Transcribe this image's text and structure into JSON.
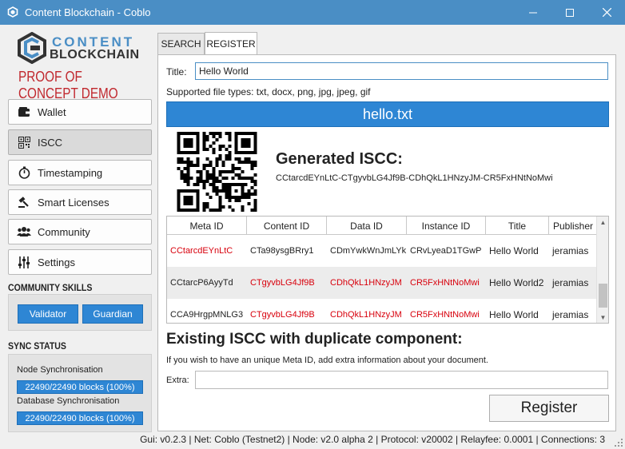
{
  "window": {
    "title": "Content Blockchain - Coblo"
  },
  "sidebar": {
    "logo": {
      "line1": "CONTENT",
      "line2": "BLOCKCHAIN"
    },
    "demo_label": "PROOF OF CONCEPT DEMO",
    "nav": [
      {
        "label": "Wallet",
        "icon": "wallet-icon"
      },
      {
        "label": "ISCC",
        "icon": "qr-code-icon"
      },
      {
        "label": "Timestamping",
        "icon": "stopwatch-icon"
      },
      {
        "label": "Smart Licenses",
        "icon": "gavel-icon"
      },
      {
        "label": "Community",
        "icon": "users-icon"
      },
      {
        "label": "Settings",
        "icon": "sliders-icon"
      }
    ],
    "active_nav": "ISCC",
    "skills_heading": "COMMUNITY SKILLS",
    "skills": {
      "validator": "Validator",
      "guardian": "Guardian"
    },
    "sync_heading": "SYNC STATUS",
    "node_sync": {
      "label": "Node Synchronisation",
      "value": "22490/22490 blocks (100%)",
      "progress": 1.0
    },
    "db_sync": {
      "label": "Database Synchronisation",
      "value": "22490/22490 blocks (100%)",
      "progress": 1.0
    }
  },
  "tabs": [
    {
      "label": "SEARCH"
    },
    {
      "label": "REGISTER"
    }
  ],
  "active_tab": "REGISTER",
  "form": {
    "title_label": "Title:",
    "title_value": "Hello World",
    "supported_types": "Supported file types: txt, docx, png, jpg, jpeg, gif",
    "file_name": "hello.txt",
    "generated_heading": "Generated ISCC:",
    "generated_code": "CCtarcdEYnLtC-CTgyvbLG4Jf9B-CDhQkL1HNzyJM-CR5FxHNtNoMwi"
  },
  "table": {
    "columns": [
      "Meta ID",
      "Content ID",
      "Data ID",
      "Instance ID",
      "Title",
      "Publisher"
    ],
    "rows": [
      {
        "cells": [
          "CCtarcdEYnLtC",
          "CTa98ysgBRry1",
          "CDmYwkWnJmLYk",
          "CRvLyeaD1TGwP",
          "Hello World",
          "jeramias"
        ],
        "red": [
          true,
          false,
          false,
          false,
          false,
          false
        ]
      },
      {
        "cells": [
          "CCtarcP6AyyTd",
          "CTgyvbLG4Jf9B",
          "CDhQkL1HNzyJM",
          "CR5FxHNtNoMwi",
          "Hello World2",
          "jeramias"
        ],
        "red": [
          false,
          true,
          true,
          true,
          false,
          false
        ]
      },
      {
        "cells": [
          "CCA9HrgpMNLG3",
          "CTgyvbLG4Jf9B",
          "CDhQkL1HNzyJM",
          "CR5FxHNtNoMwi",
          "Hello World",
          "jeramias"
        ],
        "red": [
          false,
          true,
          true,
          true,
          false,
          false
        ]
      }
    ]
  },
  "duplicate": {
    "heading": "Existing ISCC with duplicate component:",
    "info": "If you wish to have an unique Meta ID, add extra information about your document.",
    "extra_label": "Extra:",
    "extra_value": ""
  },
  "register_label": "Register",
  "status_bar": "Gui: v0.2.3 | Net: Coblo (Testnet2) | Node: v2.0 alpha 2 | Protocol: v20002 | Relayfee: 0.0001 | Connections: 3",
  "colors": {
    "accent": "#2e86d4",
    "titlebar": "#4a8ec5",
    "demo_red": "#c0272d",
    "duplicate_red": "#d8000c"
  }
}
